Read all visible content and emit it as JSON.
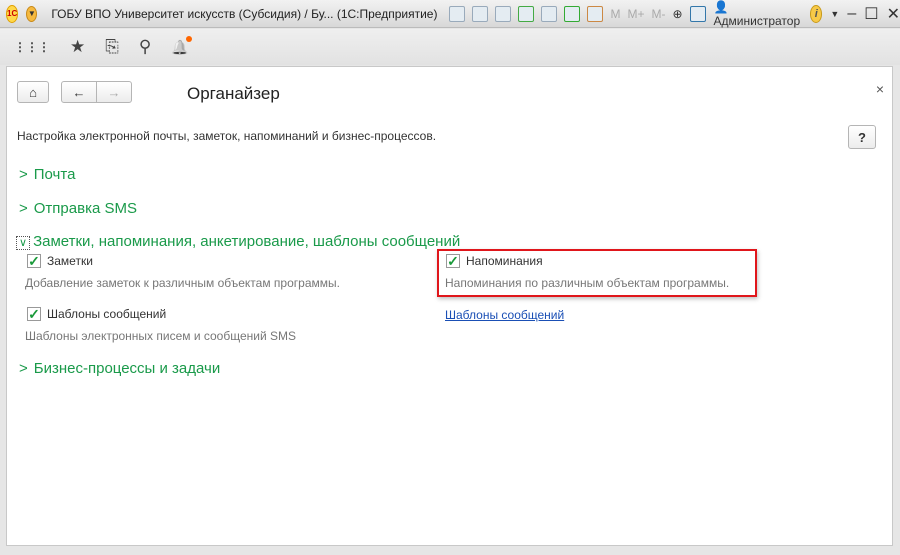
{
  "titlebar": {
    "logo": "1С",
    "title": "ГОБУ ВПО Университет искусств (Субсидия) / Бу...  (1С:Предприятие)",
    "m": "M",
    "mplus": "M+",
    "mminus": "M-",
    "user": "Администратор",
    "info": "i",
    "minimize": "–",
    "maximize": "☐",
    "close": "✕"
  },
  "toolbar": {
    "apps": "⋮⋮⋮",
    "favorites": "★",
    "history": "⎘",
    "search": "⚲",
    "notifications": "🔔"
  },
  "form": {
    "title": "Органайзер",
    "home": "⌂",
    "back": "←",
    "forward": "→",
    "close": "×",
    "help": "?",
    "description": "Настройка электронной почты, заметок, напоминаний и бизнес-процессов.",
    "groups": [
      {
        "label": "Почта",
        "chevron": ">"
      },
      {
        "label": "Отправка SMS",
        "chevron": ">"
      },
      {
        "label": "Заметки, напоминания, анкетирование, шаблоны сообщений",
        "chevron": "∨"
      },
      {
        "label": "Бизнес-процессы и задачи",
        "chevron": ">"
      }
    ],
    "notes": {
      "label": "Заметки",
      "checked": true,
      "hint": "Добавление заметок к различным объектам программы."
    },
    "reminders": {
      "label": "Напоминания",
      "checked": true,
      "hint": "Напоминания по различным объектам программы."
    },
    "templates": {
      "label": "Шаблоны сообщений",
      "checked": true,
      "hint": "Шаблоны электронных писем и сообщений SMS",
      "link": "Шаблоны сообщений"
    },
    "check": "✓"
  }
}
